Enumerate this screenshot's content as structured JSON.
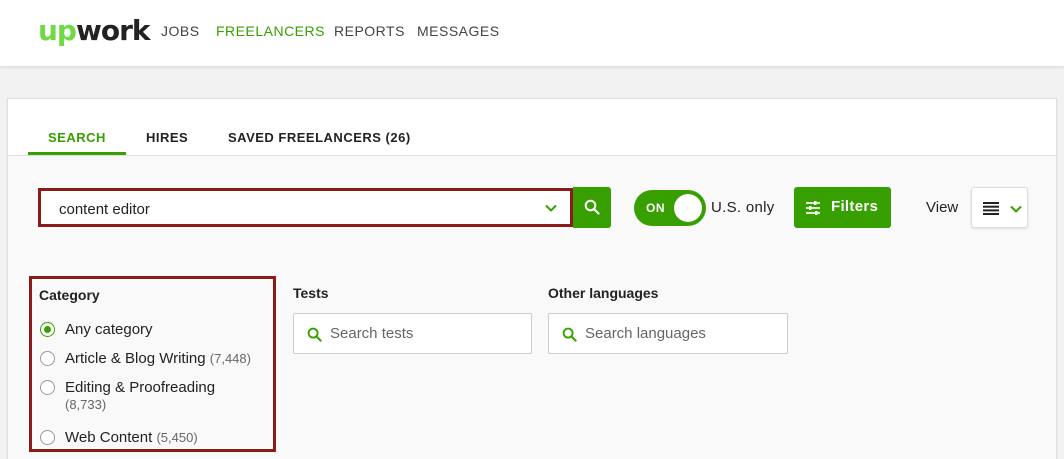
{
  "logo": {
    "part1": "up",
    "part2": "work"
  },
  "nav": {
    "items": [
      {
        "label": "JOBS",
        "active": false
      },
      {
        "label": "FREELANCERS",
        "active": true
      },
      {
        "label": "REPORTS",
        "active": false
      },
      {
        "label": "MESSAGES",
        "active": false
      }
    ]
  },
  "tabs": {
    "items": [
      {
        "label": "SEARCH",
        "active": true
      },
      {
        "label": "HIRES",
        "active": false
      },
      {
        "label": "SAVED FREELANCERS (26)",
        "active": false
      }
    ]
  },
  "search": {
    "value": "content editor"
  },
  "us_toggle": {
    "state_label": "ON",
    "label": "U.S. only"
  },
  "filters_button": {
    "label": "Filters"
  },
  "view": {
    "label": "View"
  },
  "category": {
    "title": "Category",
    "options": [
      {
        "label": "Any category",
        "count": "",
        "checked": true
      },
      {
        "label": "Article & Blog Writing",
        "count": "(7,448)",
        "checked": false
      },
      {
        "label": "Editing & Proofreading",
        "count": "(8,733)",
        "checked": false
      },
      {
        "label": "Web Content",
        "count": "(5,450)",
        "checked": false
      }
    ]
  },
  "tests": {
    "title": "Tests",
    "placeholder": "Search tests"
  },
  "languages": {
    "title": "Other languages",
    "placeholder": "Search languages"
  },
  "colors": {
    "brand_green": "#37a000",
    "logo_green": "#6fda44",
    "highlight_red": "#8b1a1a"
  }
}
